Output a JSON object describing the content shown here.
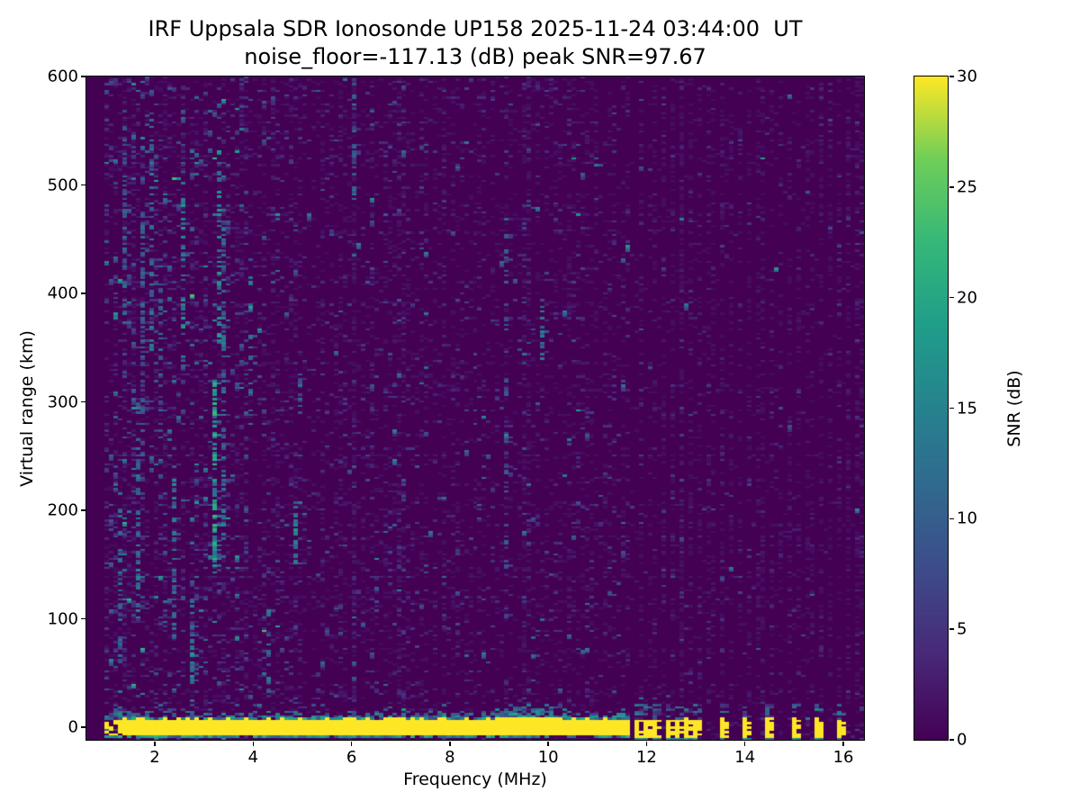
{
  "chart_data": {
    "type": "heatmap",
    "title": "IRF Uppsala SDR Ionosonde UP158 2025-11-24 03:44:00  UT",
    "subtitle": "noise_floor=-117.13 (dB) peak SNR=97.67",
    "xlabel": "Frequency (MHz)",
    "ylabel": "Virtual range (km)",
    "xlim": [
      0.61,
      16.42
    ],
    "ylim": [
      -11.6,
      600
    ],
    "xticks": [
      2,
      4,
      6,
      8,
      10,
      12,
      14,
      16
    ],
    "yticks": [
      0,
      100,
      200,
      300,
      400,
      500,
      600
    ],
    "colorbar": {
      "label": "SNR (dB)",
      "ticks": [
        0,
        5,
        10,
        15,
        20,
        25,
        30
      ],
      "vmin": 0,
      "vmax": 30,
      "colormap": "viridis"
    },
    "viridis_stops": [
      "#440154",
      "#482878",
      "#3e4a89",
      "#31688e",
      "#26828e",
      "#1f9e89",
      "#35b779",
      "#6ece58",
      "#fde725"
    ],
    "background_snr_db": 0,
    "data_min_freq_mhz": 1.02,
    "ground_echo_band": {
      "center_km": 0,
      "core_km": [
        -6.5,
        8
      ],
      "solid_freq_mhz": [
        1.05,
        11.66
      ],
      "snr_db": 30,
      "fringe_above_km": [
        8,
        13
      ],
      "fringe_below_km": [
        -8.8,
        -6.5
      ],
      "bump_center_mhz": 9.55,
      "bump_top_km": 20,
      "left_bump_center_mhz": 1.22
    },
    "pulsed_bars_mhz": [
      11.8,
      12.0,
      12.2,
      12.4,
      12.6,
      12.8,
      13.03,
      13.5,
      14.0,
      14.5,
      14.96,
      15.47,
      15.93
    ],
    "bar_core_km": [
      -10,
      8
    ],
    "periodic_columns": {
      "start_mhz": 11.72,
      "spacing_mhz": 0.2,
      "density": 0.3
    },
    "noise_regions": [
      {
        "freq_mhz": [
          1.02,
          1.75
        ],
        "density": 0.34,
        "mean_snr_db": 3.2,
        "hot_prob": 0.05
      },
      {
        "freq_mhz": [
          1.75,
          4.3
        ],
        "density": 0.3,
        "mean_snr_db": 3.0,
        "hot_prob": 0.04
      },
      {
        "freq_mhz": [
          4.3,
          8.0
        ],
        "density": 0.24,
        "mean_snr_db": 2.2,
        "hot_prob": 0.015
      },
      {
        "freq_mhz": [
          8.0,
          11.7
        ],
        "density": 0.2,
        "mean_snr_db": 2.0,
        "hot_prob": 0.01
      },
      {
        "freq_mhz": [
          11.7,
          16.42
        ],
        "density": 0.04,
        "mean_snr_db": 1.6,
        "hot_prob": 0.004
      }
    ],
    "rfi_streaks": [
      {
        "f": 1.3,
        "km": [
          60,
          200
        ],
        "snr": 10,
        "d": 0.45
      },
      {
        "f": 1.42,
        "km": [
          380,
          560
        ],
        "snr": 9,
        "d": 0.35
      },
      {
        "f": 1.62,
        "km": [
          90,
          300
        ],
        "snr": 12,
        "d": 0.4
      },
      {
        "f": 1.78,
        "km": [
          250,
          480
        ],
        "snr": 9,
        "d": 0.3
      },
      {
        "f": 1.95,
        "km": [
          340,
          570
        ],
        "snr": 11,
        "d": 0.35
      },
      {
        "f": 2.12,
        "km": [
          240,
          430
        ],
        "snr": 10,
        "d": 0.35
      },
      {
        "f": 2.35,
        "km": [
          90,
          240
        ],
        "snr": 12,
        "d": 0.4
      },
      {
        "f": 2.62,
        "km": [
          320,
          520
        ],
        "snr": 13,
        "d": 0.4
      },
      {
        "f": 2.8,
        "km": [
          40,
          120
        ],
        "snr": 14,
        "d": 0.5
      },
      {
        "f": 3.22,
        "km": [
          140,
          320
        ],
        "snr": 17,
        "d": 0.6
      },
      {
        "f": 3.28,
        "km": [
          350,
          530
        ],
        "snr": 14,
        "d": 0.4
      },
      {
        "f": 3.4,
        "km": [
          170,
          460
        ],
        "snr": 12,
        "d": 0.35
      },
      {
        "f": 3.95,
        "km": [
          280,
          420
        ],
        "snr": 11,
        "d": 0.35
      },
      {
        "f": 4.32,
        "km": [
          20,
          110
        ],
        "snr": 10,
        "d": 0.35
      },
      {
        "f": 4.9,
        "km": [
          150,
          210
        ],
        "snr": 13,
        "d": 0.55
      },
      {
        "f": 4.97,
        "km": [
          290,
          330
        ],
        "snr": 10,
        "d": 0.4
      },
      {
        "f": 6.05,
        "km": [
          480,
          590
        ],
        "snr": 10,
        "d": 0.35
      },
      {
        "f": 9.12,
        "km": [
          100,
          470
        ],
        "snr": 8,
        "d": 0.25
      },
      {
        "f": 9.85,
        "km": [
          340,
          400
        ],
        "snr": 11,
        "d": 0.4
      }
    ]
  }
}
